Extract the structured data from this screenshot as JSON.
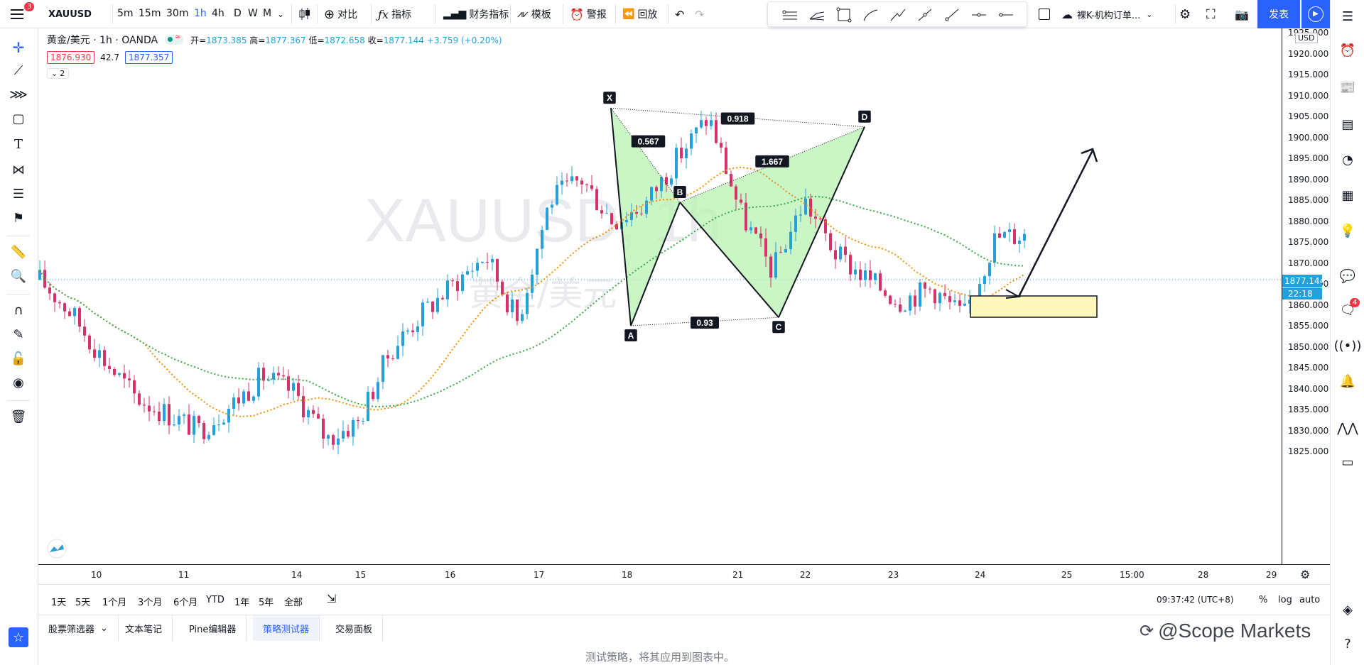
{
  "toolbar": {
    "menu_badge": "3",
    "symbol": "XAUUSD",
    "intervals": [
      "5m",
      "15m",
      "30m",
      "1h",
      "4h",
      "D",
      "W",
      "M"
    ],
    "active_interval": "1h",
    "compare_label": "对比",
    "indicators_label": "指标",
    "financials_label": "财务指标",
    "templates_label": "模板",
    "alert_label": "警报",
    "replay_label": "回放",
    "layout_name": "裸K-机构订单...",
    "publish_label": "发表"
  },
  "legend": {
    "title": "黄金/美元 · 1h · OANDA",
    "open_label": "开=",
    "open": "1873.385",
    "high_label": "高=",
    "high": "1877.367",
    "low_label": "低=",
    "low": "1872.658",
    "close_label": "收=",
    "close": "1877.144",
    "change": "+3.759 (+0.20%)",
    "bid": "1876.930",
    "spread": "42.7",
    "ask": "1877.357",
    "collapsed_count": "2"
  },
  "watermark": {
    "symbol": "XAUUSD, 1h",
    "name": "黄金/美元"
  },
  "price_scale": {
    "currency": "USD",
    "labels": [
      "1925.000",
      "1920.000",
      "1915.000",
      "1910.000",
      "1905.000",
      "1900.000",
      "1895.000",
      "1890.000",
      "1885.000",
      "1880.000",
      "1875.000",
      "1870.000",
      "1865.000",
      "1860.000",
      "1855.000",
      "1850.000",
      "1845.000",
      "1840.000",
      "1835.000",
      "1830.000",
      "1825.000"
    ],
    "current_price": "1877.144",
    "countdown": "22:18"
  },
  "time_scale": {
    "labels": [
      "10",
      "11",
      "14",
      "15",
      "16",
      "17",
      "18",
      "21",
      "22",
      "23",
      "24",
      "25",
      "15:00",
      "28",
      "29"
    ]
  },
  "range_bar": {
    "ranges": [
      "1天",
      "5天",
      "1个月",
      "3个月",
      "6个月",
      "YTD",
      "1年",
      "5年",
      "全部"
    ],
    "clock": "09:37:42 (UTC+8)",
    "percent": "%",
    "log": "log",
    "auto": "auto"
  },
  "bottom_panel": {
    "tabs": [
      "股票筛选器",
      "文本笔记",
      "Pine编辑器",
      "策略测试器",
      "交易面板"
    ],
    "active_tab": "策略测试器",
    "message": "测试策略，将其应用到图表中。",
    "watermark": "@Scope Markets"
  },
  "right_bar": {
    "notification_count": "4"
  },
  "pattern": {
    "points": {
      "X": "X",
      "A": "A",
      "B": "B",
      "C": "C",
      "D": "D"
    },
    "ratios": {
      "xab": "0.567",
      "xad": "0.918",
      "abcd": "1.667",
      "abc": "0.93"
    }
  },
  "colors": {
    "up": "#26a0da",
    "down": "#d5326b",
    "ma_fast": "#f0900a",
    "ma_slow": "#3aa845",
    "pattern_fill": "#b8f2b0",
    "accent": "#2962ff",
    "zone_fill": "#fff8bd"
  },
  "chart_data": {
    "type": "candlestick",
    "symbol": "XAUUSD",
    "interval": "1h",
    "ylim": [
      1822,
      1927
    ],
    "x": [
      "10",
      "11",
      "14",
      "15",
      "16",
      "17",
      "18",
      "21",
      "22",
      "23",
      "24",
      "25",
      "15:00",
      "28",
      "29"
    ],
    "series": [
      {
        "name": "XAUUSD",
        "close_path": [
          1866,
          1858,
          1847,
          1838,
          1834,
          1830,
          1836,
          1843,
          1839,
          1828,
          1832,
          1849,
          1858,
          1865,
          1872,
          1856,
          1885,
          1890,
          1880,
          1884,
          1895,
          1905,
          1882,
          1868,
          1885,
          1872,
          1866,
          1861,
          1864,
          1857,
          1876,
          1877
        ]
      }
    ],
    "pattern_prices": {
      "X": 1907,
      "A": 1855,
      "B": 1884.5,
      "C": 1857,
      "D": 1902.5
    },
    "last_price": 1877.144
  }
}
